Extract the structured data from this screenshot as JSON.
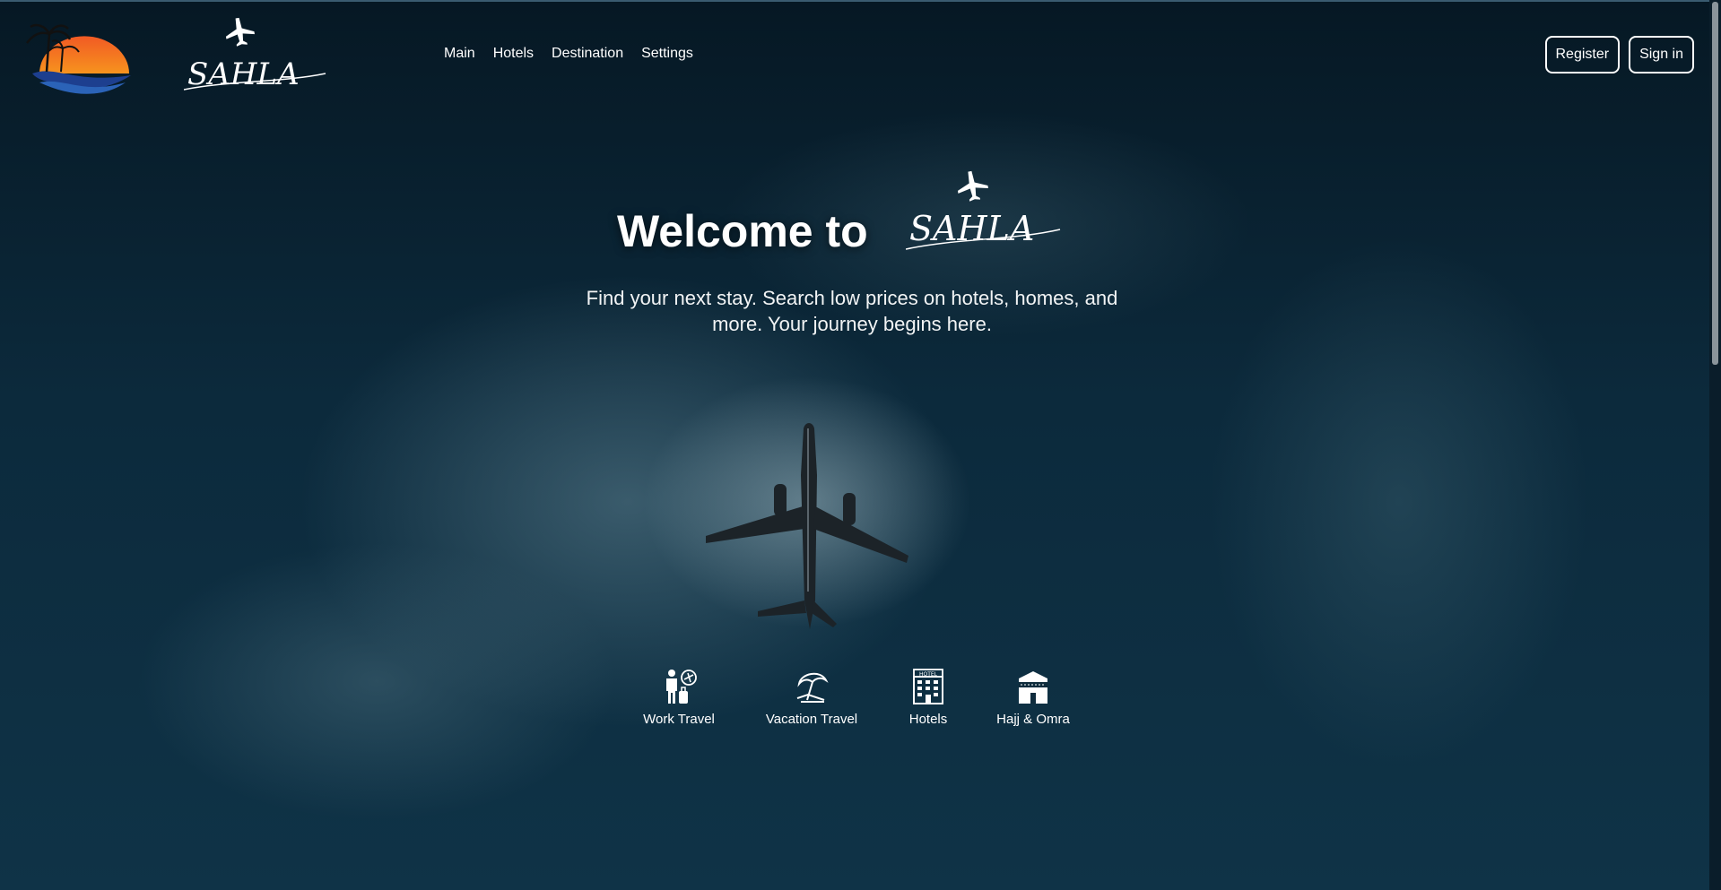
{
  "header": {
    "brand_name": "SAHLA",
    "nav": [
      {
        "label": "Main"
      },
      {
        "label": "Hotels"
      },
      {
        "label": "Destination"
      },
      {
        "label": "Settings"
      }
    ],
    "register_label": "Register",
    "signin_label": "Sign in"
  },
  "hero": {
    "welcome_text": "Welcome to",
    "brand_name": "SAHLA",
    "tagline": "Find your next stay. Search low prices on hotels, homes, and more. Your journey begins here."
  },
  "categories": [
    {
      "label": "Work Travel",
      "icon": "business-traveler-icon"
    },
    {
      "label": "Vacation Travel",
      "icon": "beach-umbrella-icon"
    },
    {
      "label": "Hotels",
      "icon": "hotel-building-icon"
    },
    {
      "label": "Hajj & Omra",
      "icon": "kaaba-icon"
    }
  ],
  "colors": {
    "sun_orange": "#f0641e",
    "wave_blue": "#1f4fa0",
    "sky_dark": "#0b2638"
  }
}
